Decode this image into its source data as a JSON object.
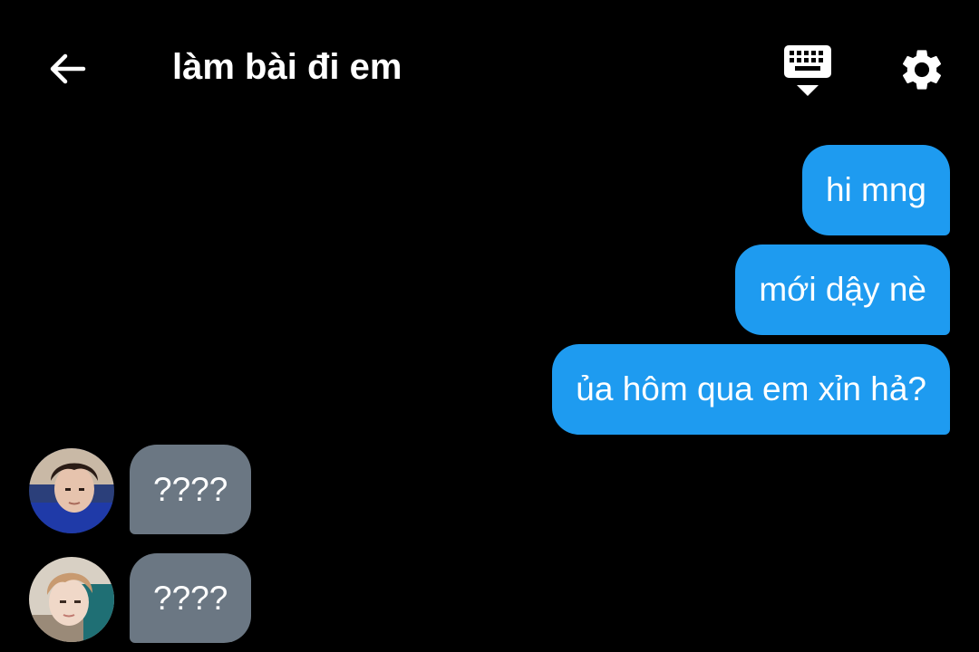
{
  "header": {
    "title": "làm bài đi em",
    "back_icon": "arrow-left-icon",
    "keyboard_icon": "keyboard-hide-icon",
    "settings_icon": "gear-icon"
  },
  "colors": {
    "background": "#000000",
    "sent_bubble": "#1e9bf0",
    "received_bubble": "#6b7783",
    "text": "#ffffff"
  },
  "messages": [
    {
      "direction": "sent",
      "text": "hi mng"
    },
    {
      "direction": "sent",
      "text": "mới dậy nè"
    },
    {
      "direction": "sent",
      "text": "ủa hôm qua em xỉn hả?"
    },
    {
      "direction": "received",
      "text": "????",
      "avatar": "avatar-photo"
    },
    {
      "direction": "received",
      "text": "????",
      "avatar": "avatar-photo"
    }
  ]
}
